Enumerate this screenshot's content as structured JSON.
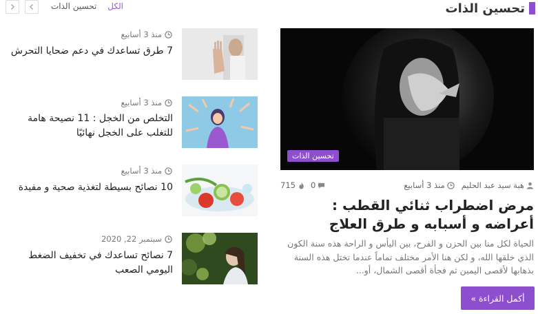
{
  "block": {
    "title": "تحسين الذات"
  },
  "filters": {
    "all": "الكل",
    "category": "تحسين الذات"
  },
  "featured": {
    "category": "تحسين الذات",
    "author": "هبة سيد عبد الحليم",
    "time": "منذ 3 أسابيع",
    "comments": "0",
    "views": "715",
    "title": "مرض اضطراب ثنائي القطب : أعراضه و أسبابه و طرق العلاج",
    "excerpt": "الحياة لكل منا بين الحزن و الفرح، بين اليأس و الراحة هذه سنة الكون الذي خلقها الله، و لكن هنا الأمر مختلف تماماً عندما تختل هذه السنة بذهابها لأقصى اليمين ثم فجأة أقصى الشمال، أو...",
    "read_more": "أكمل القراءة »"
  },
  "posts": [
    {
      "time": "منذ 3 أسابيع",
      "title": "7 طرق تساعدك في دعم ضحايا التحرش"
    },
    {
      "time": "منذ 3 أسابيع",
      "title": "التخلص من الخجل : 11 نصيحة هامة للتغلب على الخجل نهائيًا"
    },
    {
      "time": "منذ 3 أسابيع",
      "title": "10 نصائح بسيطة لتغذية صحية و مفيدة"
    },
    {
      "time": "سبتمبر 22, 2020",
      "title": "7 نصائح تساعدك في تخفيف الضغط اليومي الصعب"
    }
  ],
  "colors": {
    "accent": "#8e4fcf"
  }
}
